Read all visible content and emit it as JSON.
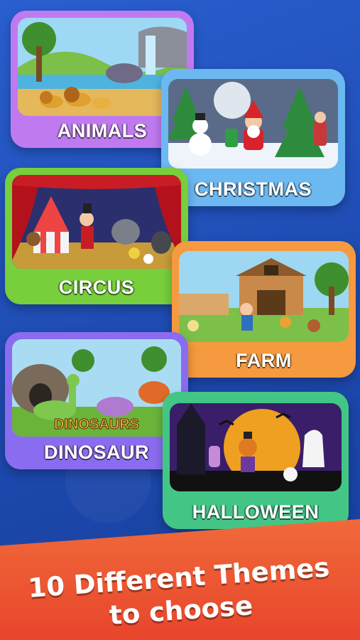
{
  "themes": [
    {
      "id": "animals",
      "label": "ANIMALS",
      "color": "#c07af0"
    },
    {
      "id": "christmas",
      "label": "CHRISTMAS",
      "color": "#6cb8f0"
    },
    {
      "id": "circus",
      "label": "CIRCUS",
      "color": "#76cf3b"
    },
    {
      "id": "farm",
      "label": "FARM",
      "color": "#f59a3e"
    },
    {
      "id": "dinosaur",
      "label": "DINOSAUR",
      "color": "#8a6cf0",
      "image_text": "DINOSAURS"
    },
    {
      "id": "halloween",
      "label": "HALLOWEEN",
      "color": "#43c685"
    }
  ],
  "banner": {
    "line1": "10 Different Themes",
    "line2": "to choose",
    "color": "#e8452c"
  },
  "background_color": "#1e4fb8"
}
